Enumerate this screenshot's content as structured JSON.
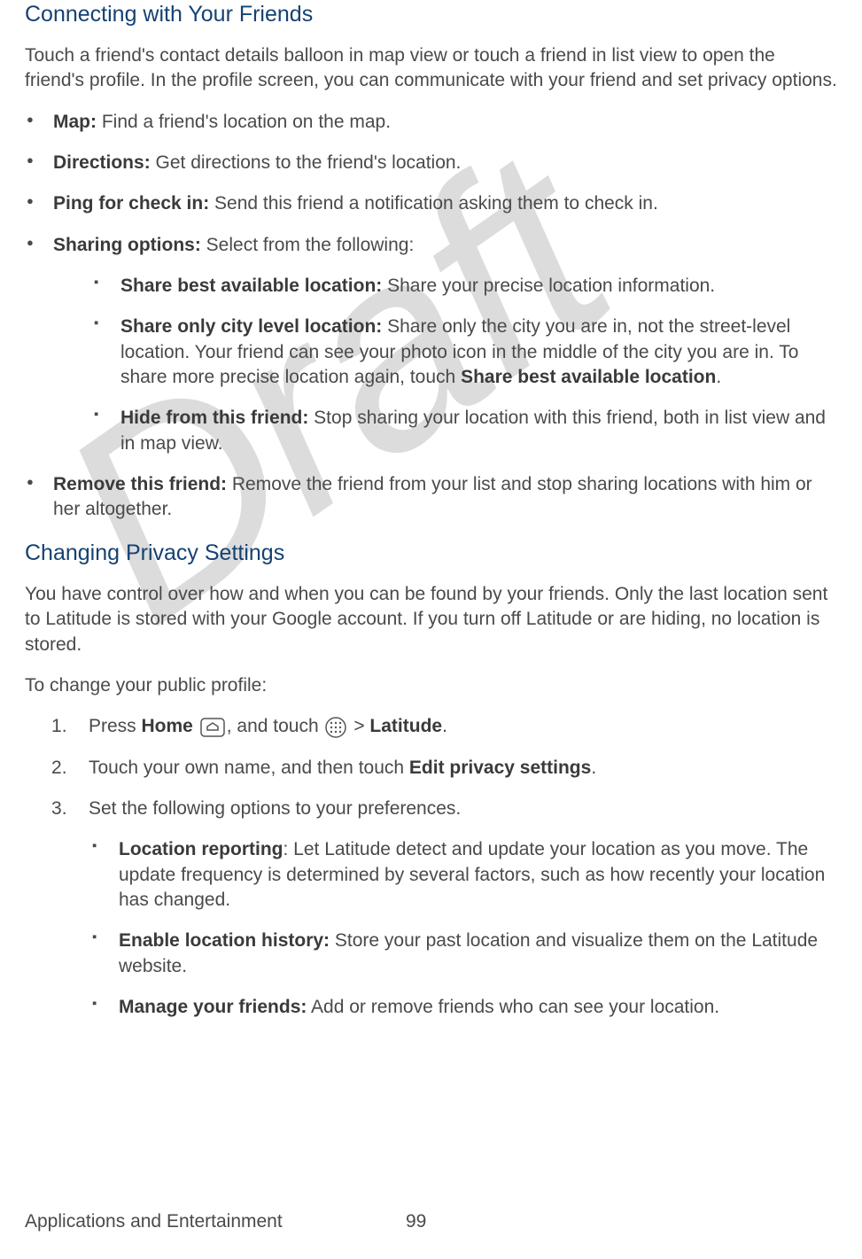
{
  "watermark": "Draft",
  "heading1": "Connecting with Your Friends",
  "intro1": "Touch a friend's contact details balloon in map view or touch a friend in list view to open the friend's profile. In the profile screen, you can communicate with your friend and set privacy options.",
  "bullets1": {
    "map_label": "Map:",
    "map_text": " Find a friend's location on the map.",
    "directions_label": "Directions:",
    "directions_text": " Get directions to the friend's location.",
    "ping_label": "Ping for check in:",
    "ping_text": " Send this friend a notification asking them to check in.",
    "sharing_label": "Sharing options:",
    "sharing_text": " Select from the following:",
    "share_best_label": "Share best available location:",
    "share_best_text": " Share your precise location information.",
    "share_city_label": "Share only city level location:",
    "share_city_text_a": " Share only the city you are in, not the street-level location. Your friend can see your photo icon in the middle of the city you are in. To share more precise location again, touch ",
    "share_city_bold": "Share best available location",
    "share_city_text_b": ".",
    "hide_label": "Hide from this friend:",
    "hide_text": " Stop sharing your location with this friend, both in list view and in map view.",
    "remove_label": "Remove this friend:",
    "remove_text": " Remove the friend from your list and stop sharing locations with him or her altogether."
  },
  "heading2": "Changing Privacy Settings",
  "intro2": "You have control over how and when you can be found by your friends. Only the last location sent to Latitude is stored with your Google account. If you turn off Latitude or are hiding, no location is stored.",
  "intro2b": "To change your public profile:",
  "steps": {
    "s1_a": "Press ",
    "s1_home": "Home",
    "s1_b": ", and touch ",
    "s1_c": " > ",
    "s1_latitude": "Latitude",
    "s1_d": ".",
    "s2_a": "Touch your own name, and then touch ",
    "s2_bold": "Edit privacy settings",
    "s2_b": ".",
    "s3": "Set the following options to your preferences."
  },
  "opts": {
    "loc_label": "Location reporting",
    "loc_text": ": Let Latitude detect and update your location as you move. The update frequency is determined by several factors, such as how recently your location has changed.",
    "hist_label": "Enable location history:",
    "hist_text": " Store your past location and visualize them on the Latitude website.",
    "manage_label": "Manage your friends:",
    "manage_text": " Add or remove friends who can see your location."
  },
  "footer": {
    "section": "Applications and Entertainment",
    "page": "99"
  }
}
